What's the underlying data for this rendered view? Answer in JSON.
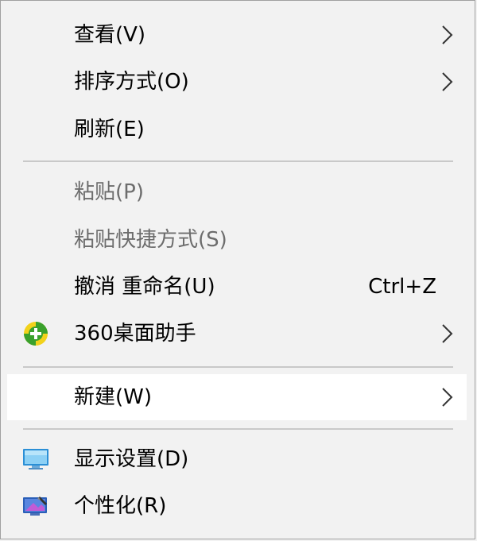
{
  "menu": {
    "items": [
      {
        "label": "查看(V)",
        "submenu": true
      },
      {
        "label": "排序方式(O)",
        "submenu": true
      },
      {
        "label": "刷新(E)"
      },
      {
        "label": "粘贴(P)",
        "disabled": true
      },
      {
        "label": "粘贴快捷方式(S)",
        "disabled": true
      },
      {
        "label": "撤消 重命名(U)",
        "shortcut": "Ctrl+Z"
      },
      {
        "label": "360桌面助手",
        "icon": "360-desktop-assistant-icon",
        "submenu": true
      },
      {
        "label": "新建(W)",
        "submenu": true,
        "highlighted": true
      },
      {
        "label": "显示设置(D)",
        "icon": "display-settings-icon"
      },
      {
        "label": "个性化(R)",
        "icon": "personalization-icon"
      }
    ]
  },
  "colors": {
    "background": "#f2f2f2",
    "highlight": "#ffffff",
    "disabled_text": "#6d6d6d",
    "separator": "#c9c9c9",
    "icon_360_green": "#3aa12c",
    "icon_360_yellow": "#f2d21b",
    "display_icon_blue": "#2b8fd6"
  }
}
